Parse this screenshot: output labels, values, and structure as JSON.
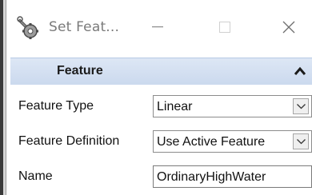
{
  "window": {
    "title": "Set Feat...",
    "app_icon": "gear-wrench-icon"
  },
  "titlebar_buttons": {
    "minimize_icon": "minimize-icon",
    "maximize_icon": "maximize-icon",
    "close_icon": "close-icon"
  },
  "section": {
    "title": "Feature",
    "collapse_icon": "chevron-up-icon"
  },
  "properties": [
    {
      "label": "Feature Type",
      "value": "Linear",
      "control": "dropdown"
    },
    {
      "label": "Feature Definition",
      "value": "Use Active Feature",
      "control": "dropdown"
    },
    {
      "label": "Name",
      "value": "OrdinaryHighWater",
      "control": "text"
    }
  ],
  "colors": {
    "section_header": "#cbd9ee",
    "title_text": "#7a7a7a"
  }
}
